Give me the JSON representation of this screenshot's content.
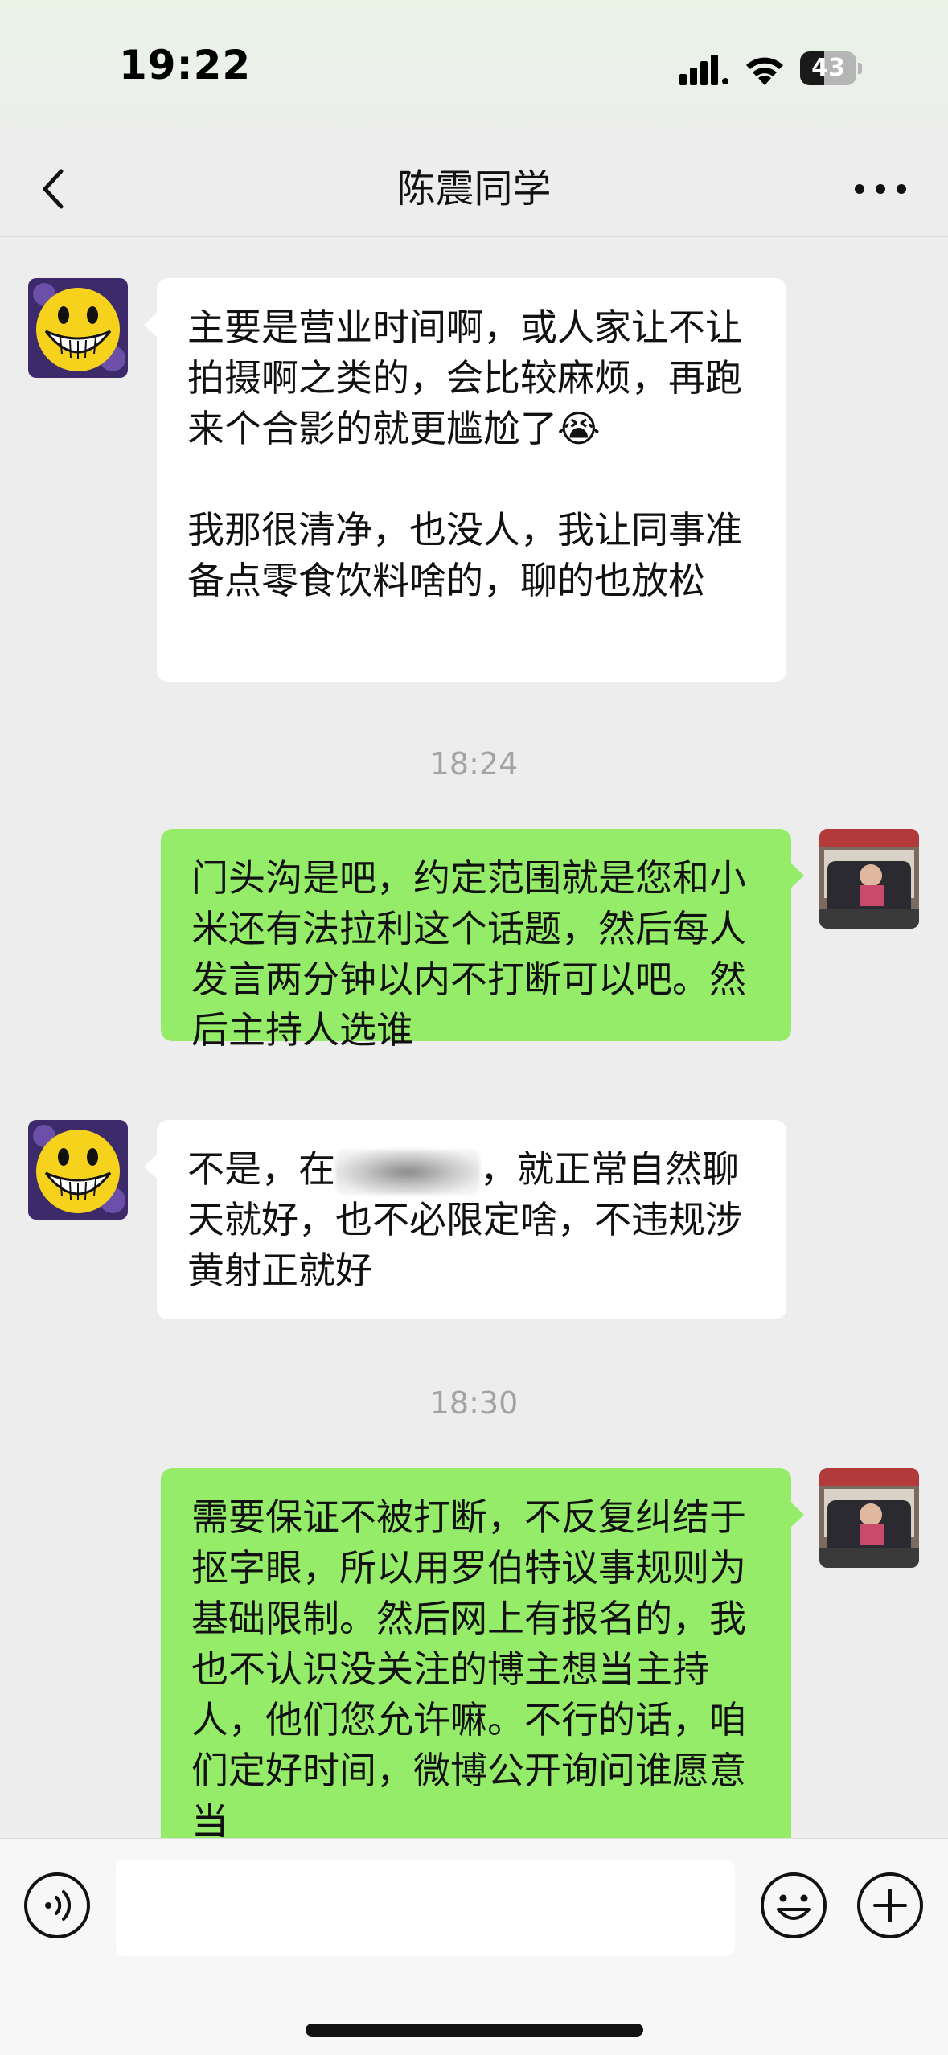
{
  "status_bar": {
    "time": "19:22",
    "battery_level": "43",
    "battery_fraction": 0.43
  },
  "header": {
    "title": "陈震同学",
    "back_icon": "chevron-left-icon",
    "more_icon": "more-dots-icon"
  },
  "messages": [
    {
      "type": "message",
      "side": "left",
      "text": "主要是营业时间啊，或人家让不让拍摄啊之类的，会比较麻烦，再跑来个合影的就更尴尬了😭\n\n我那很清净，也没人，我让同事准备点零食饮料啥的，聊的也放松"
    },
    {
      "type": "time",
      "text": "18:24"
    },
    {
      "type": "message",
      "side": "right",
      "text": "门头沟是吧，约定范围就是您和小米还有法拉利这个话题，然后每人发言两分钟以内不打断可以吧。然后主持人选谁"
    },
    {
      "type": "message",
      "side": "left",
      "text_before": "不是，在",
      "text_after": "，就正常自然聊天就好，也不必限定啥，不违规涉黄射正就好"
    },
    {
      "type": "time",
      "text": "18:30"
    },
    {
      "type": "message",
      "side": "right",
      "text": "需要保证不被打断，不反复纠结于抠字眼，所以用罗伯特议事规则为基础限制。然后网上有报名的，我也不认识没关注的博主想当主持人，他们您允许嘛。不行的话，咱们定好时间，微博公开询问谁愿意当"
    }
  ],
  "input_bar": {
    "voice_icon": "voice-icon",
    "emoji_icon": "emoji-icon",
    "plus_icon": "plus-icon",
    "input_value": ""
  },
  "colors": {
    "background": "#ededed",
    "bubble_self": "#95ec69",
    "bubble_other": "#ffffff",
    "timestamp": "#a3a3a3"
  }
}
